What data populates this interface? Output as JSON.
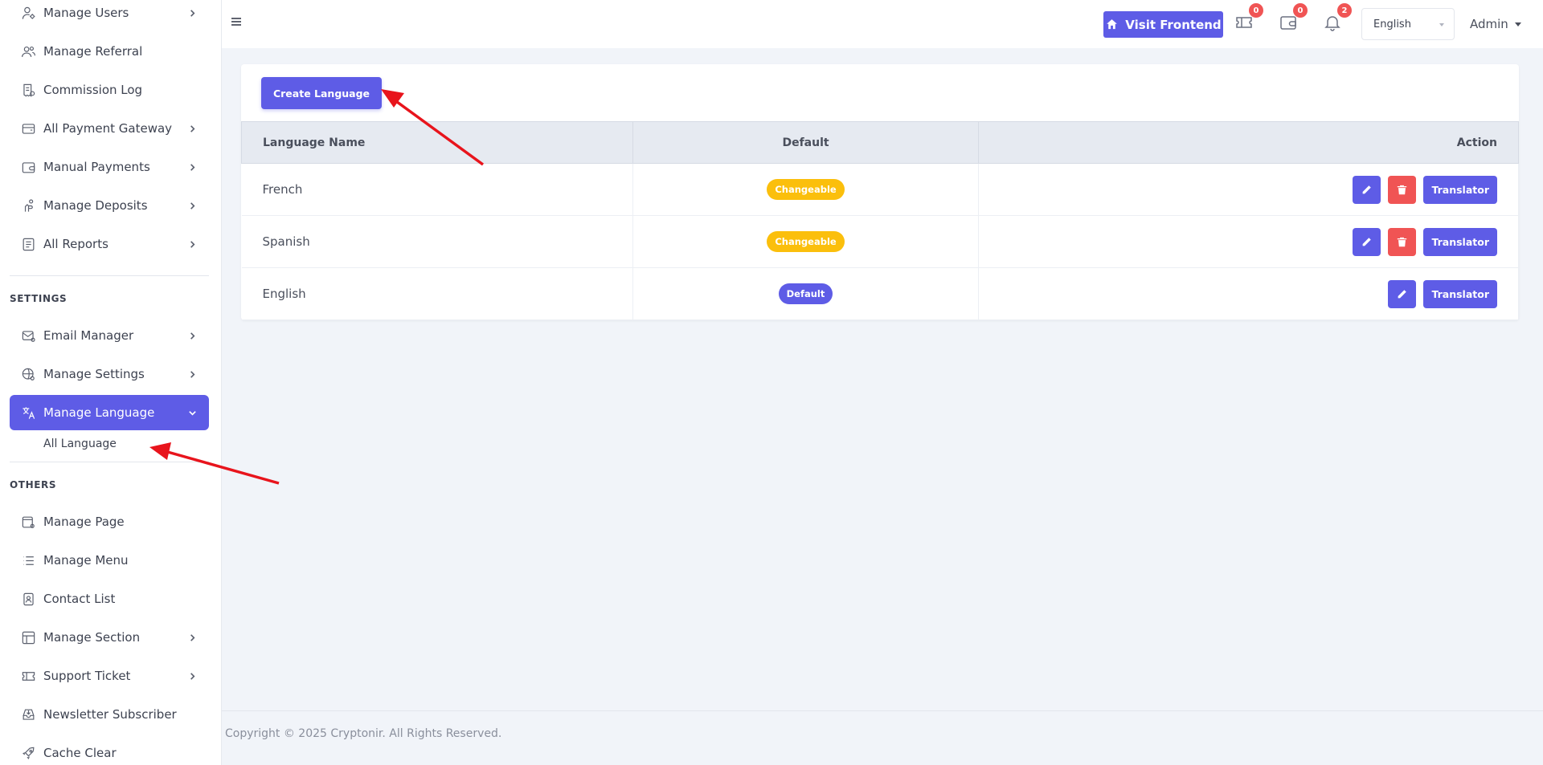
{
  "sidebar": {
    "items_top": [
      {
        "label": "Manage Users",
        "icon": "user-cog-icon",
        "chevron": true
      },
      {
        "label": "Manage Referral",
        "icon": "users-icon",
        "chevron": false
      },
      {
        "label": "Commission Log",
        "icon": "receipt-icon",
        "chevron": false
      },
      {
        "label": "All Payment Gateway",
        "icon": "wallet-card-icon",
        "chevron": true
      },
      {
        "label": "Manual Payments",
        "icon": "wallet-icon",
        "chevron": true
      },
      {
        "label": "Manage Deposits",
        "icon": "hand-coin-icon",
        "chevron": true
      },
      {
        "label": "All Reports",
        "icon": "report-icon",
        "chevron": true
      }
    ],
    "section_settings": "SETTINGS",
    "items_settings": [
      {
        "label": "Email Manager",
        "icon": "mail-settings-icon",
        "chevron": true
      },
      {
        "label": "Manage Settings",
        "icon": "globe-settings-icon",
        "chevron": true
      },
      {
        "label": "Manage Language",
        "icon": "translate-icon",
        "chevron": true,
        "active": true
      }
    ],
    "sub_all_language": "All Language",
    "section_others": "OTHERS",
    "items_others": [
      {
        "label": "Manage Page",
        "icon": "page-settings-icon",
        "chevron": false
      },
      {
        "label": "Manage Menu",
        "icon": "list-icon",
        "chevron": false
      },
      {
        "label": "Contact List",
        "icon": "contact-book-icon",
        "chevron": false
      },
      {
        "label": "Manage Section",
        "icon": "layout-icon",
        "chevron": true
      },
      {
        "label": "Support Ticket",
        "icon": "ticket-icon",
        "chevron": true
      },
      {
        "label": "Newsletter Subscriber",
        "icon": "inbox-download-icon",
        "chevron": false
      },
      {
        "label": "Cache Clear",
        "icon": "rocket-icon",
        "chevron": false
      }
    ]
  },
  "topbar": {
    "visit_frontend": "Visit Frontend",
    "ticket_count": "0",
    "wallet_count": "0",
    "notification_count": "2",
    "language": "English",
    "admin": "Admin"
  },
  "main": {
    "create_button": "Create Language",
    "columns": [
      "Language Name",
      "Default",
      "Action"
    ],
    "rows": [
      {
        "name": "French",
        "status": "Changeable",
        "translator": "Translator"
      },
      {
        "name": "Spanish",
        "status": "Changeable",
        "translator": "Translator"
      },
      {
        "name": "English",
        "status": "Default",
        "translator": "Translator"
      }
    ]
  },
  "footer": {
    "copyright": "Copyright © 2025 Cryptonir. All Rights Reserved."
  },
  "colors": {
    "primary": "#5e5ce6",
    "danger": "#f05454",
    "warning": "#fbbf0c",
    "annotation": "#e8141c"
  }
}
